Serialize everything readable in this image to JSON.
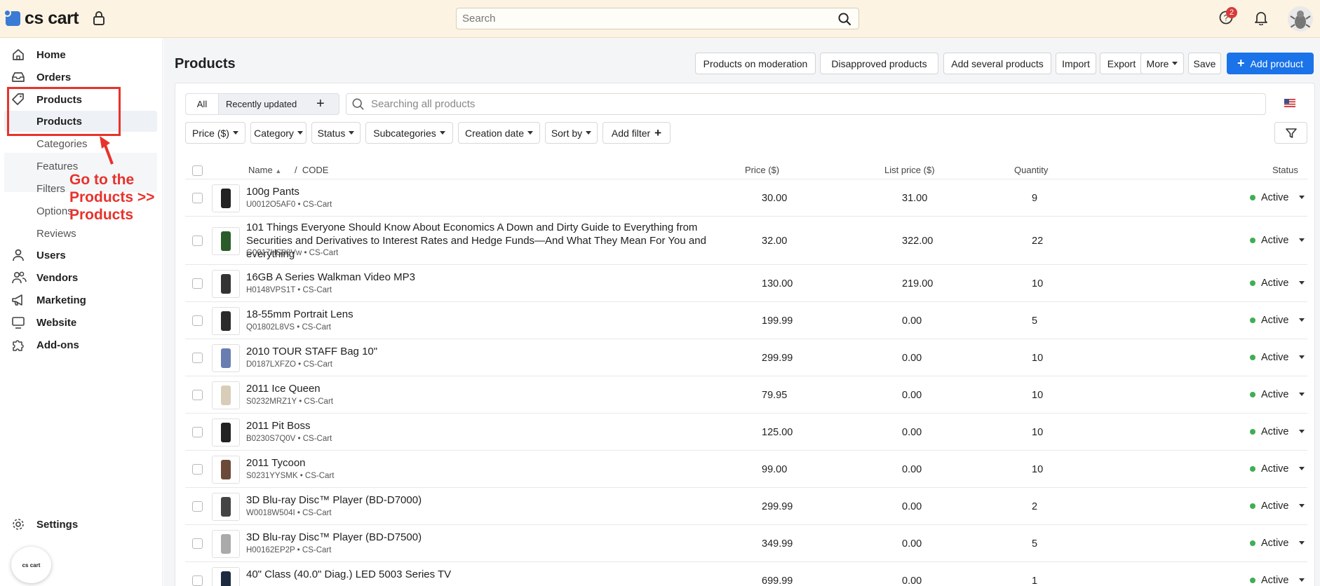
{
  "app": {
    "logo_text": "cs cart",
    "badge_text": "cs cart"
  },
  "topbar": {
    "search_placeholder": "Search",
    "help_count": "2"
  },
  "sidebar": {
    "items": [
      {
        "label": "Home",
        "icon": "home-icon"
      },
      {
        "label": "Orders",
        "icon": "inbox-icon"
      },
      {
        "label": "Products",
        "icon": "tag-icon"
      },
      {
        "label": "Users",
        "icon": "user-icon"
      },
      {
        "label": "Vendors",
        "icon": "users-icon"
      },
      {
        "label": "Marketing",
        "icon": "megaphone-icon"
      },
      {
        "label": "Website",
        "icon": "monitor-icon"
      },
      {
        "label": "Add-ons",
        "icon": "puzzle-icon"
      }
    ],
    "subitems": [
      "Products",
      "Categories",
      "Features",
      "Filters",
      "Options",
      "Reviews"
    ],
    "settings": "Settings",
    "annotation": "Go to the Products >> Products"
  },
  "page": {
    "title": "Products",
    "toolbar": [
      "Products on moderation",
      "Disapproved products",
      "Add several products",
      "Import",
      "Export",
      "More",
      "Save"
    ],
    "add_product": "Add product"
  },
  "tabs": {
    "all": "All",
    "recent": "Recently updated",
    "add": "+"
  },
  "search": {
    "placeholder": "Searching all products"
  },
  "filters": [
    "Price ($)",
    "Category",
    "Status",
    "Subcategories",
    "Creation date",
    "Sort by",
    "Add filter"
  ],
  "table": {
    "headers": {
      "name": "Name",
      "code": "CODE",
      "price": "Price ($)",
      "list_price": "List price ($)",
      "quantity": "Quantity",
      "status": "Status"
    },
    "rows": [
      {
        "name": "100g Pants",
        "code": "U0012O5AF0 • CS-Cart",
        "price": "30.00",
        "list_price": "31.00",
        "quantity": "9",
        "status": "Active"
      },
      {
        "name": "101 Things Everyone Should Know About Economics A Down and Dirty Guide to Everything from Securities and Derivatives to Interest Rates and Hedge Funds—And What They Mean For You and everything",
        "code": "G0017HS88Vw • CS-Cart",
        "price": "32.00",
        "list_price": "322.00",
        "quantity": "22",
        "status": "Active"
      },
      {
        "name": "16GB A Series Walkman Video MP3",
        "code": "H0148VPS1T • CS-Cart",
        "price": "130.00",
        "list_price": "219.00",
        "quantity": "10",
        "status": "Active"
      },
      {
        "name": "18-55mm Portrait Lens",
        "code": "Q01802L8VS • CS-Cart",
        "price": "199.99",
        "list_price": "0.00",
        "quantity": "5",
        "status": "Active"
      },
      {
        "name": "2010 TOUR STAFF Bag 10\"",
        "code": "D0187LXFZO • CS-Cart",
        "price": "299.99",
        "list_price": "0.00",
        "quantity": "10",
        "status": "Active"
      },
      {
        "name": "2011 Ice Queen",
        "code": "S0232MRZ1Y • CS-Cart",
        "price": "79.95",
        "list_price": "0.00",
        "quantity": "10",
        "status": "Active"
      },
      {
        "name": "2011 Pit Boss",
        "code": "B0230S7Q0V • CS-Cart",
        "price": "125.00",
        "list_price": "0.00",
        "quantity": "10",
        "status": "Active"
      },
      {
        "name": "2011 Tycoon",
        "code": "S0231YYSMK • CS-Cart",
        "price": "99.00",
        "list_price": "0.00",
        "quantity": "10",
        "status": "Active"
      },
      {
        "name": "3D Blu-ray Disc™ Player (BD-D7000)",
        "code": "W0018W504I • CS-Cart",
        "price": "299.99",
        "list_price": "0.00",
        "quantity": "2",
        "status": "Active"
      },
      {
        "name": "3D Blu-ray Disc™ Player (BD-D7500)",
        "code": "H00162EP2P • CS-Cart",
        "price": "349.99",
        "list_price": "0.00",
        "quantity": "5",
        "status": "Active"
      },
      {
        "name": "40\" Class (40.0\" Diag.) LED 5003 Series TV",
        "code": "",
        "price": "699.99",
        "list_price": "0.00",
        "quantity": "1",
        "status": "Active"
      }
    ]
  }
}
